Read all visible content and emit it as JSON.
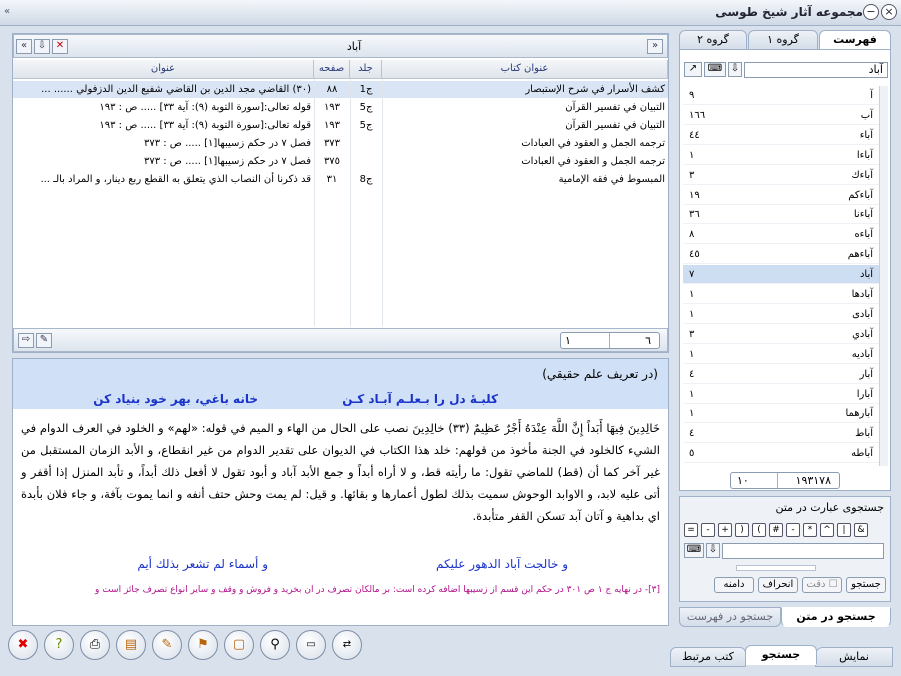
{
  "window": {
    "title": "مجموعه آثار شیخ طوسی",
    "close_icon": "×",
    "minimize_icon": "−",
    "left_arrow": "«"
  },
  "results": {
    "header_title": "آباد",
    "nav_left": "«",
    "nav_right": "»",
    "columns": {
      "book": "عنوان کتاب",
      "volume": "جلد",
      "page": "صفحه",
      "title": "عنوان"
    },
    "rows": [
      {
        "book": "كشف الأسرار في شرح الإستبصار",
        "volume": "ج1",
        "page": "٨٨",
        "title": "(٣٠) القاضي مجد الدين بن القاضي شفيع الدين الدزفولي ...... ...",
        "selected": true
      },
      {
        "book": "التبيان في تفسير القرآن",
        "volume": "ج5",
        "page": "١٩٣",
        "title": "قوله تعالى:[سورة التوبة (٩): آية ٣٣] ..... ص : ١٩٣",
        "selected": false
      },
      {
        "book": "التبيان في تفسير القرآن",
        "volume": "ج5",
        "page": "١٩٣",
        "title": "قوله تعالى:[سورة التوبة (٩): آية ٣٣] ..... ص : ١٩٣",
        "selected": false
      },
      {
        "book": "ترجمه الجمل و العقود في العبادات",
        "volume": "",
        "page": "٣٧٣",
        "title": "فصل ٧ در حكم زسيبها[١] ..... ص : ٣٧٣",
        "selected": false
      },
      {
        "book": "ترجمه الجمل و العقود في العبادات",
        "volume": "",
        "page": "٣٧٥",
        "title": "فصل ٧ در حكم زسيبها[١] ..... ص : ٣٧٣",
        "selected": false
      },
      {
        "book": "المبسوط في فقه الإمامية",
        "volume": "ج8",
        "page": "٣١",
        "title": "قد ذكرنا أن النصاب الذي يتعلق به القطع ربع دينار، و المراد بالـ ...",
        "selected": false
      }
    ],
    "pager_current": "٦",
    "pager_total": "١"
  },
  "detail": {
    "heading": "(در تعريف علم حقيقي)",
    "verse_right": "كلبـهٔ دل را بـعلـم آبـاد كـن",
    "verse_left": "خانه باغي، بهر خود بنياد كن",
    "para": "خَالِدِينَ فِيهَا أَبَداً إِنَّ اللَّهَ عِنْدَهُ أَجْرٌ عَظِيمٌ (٣٣) خالِدِينَ نصب على الحال من الهاء و الميم في قوله: «لهم» و الخلود في العرف الدوام في الشيء كالخلود في الجنة مأخوذ من قولهم: خلد هذا الكتاب في الديوان على تقدير الدوام من غير انقطاع، و الأبد الزمان المستقبل من غير آخر كما أن (قط) للماضي تقول: ما رأيته قط، و لا أراه أبداً و جمع الأبد آباد و أبود تقول لا أفعل ذلك أبداً، و تأبد المنزل إذا أقفر و أتى عليه لابد، و الاوابد الوحوش سميت بذلك لطول أعمارها و بقائها. و قيل: لم يمت وحش حتف أنفه و انما يموت بآفة، و جاء فلان بأبدة اي بداهية و آتان آبد تسكن القفر متأبدة.",
    "verse2_right": "و خالجت آباد الدهور عليكم",
    "verse2_left": "و أسماء لم تشعر بذلك أيم",
    "footnote": "[٣]- در نهايه ج ١ ص ٣٠١ در حكم اين قسم از زسيبها اضافه كرده است: بر مالكان تصرف در آن بخريد و فروش و وقف و ساير انواع تصرف جائز است و"
  },
  "right_panel": {
    "tabs": [
      "فهرست",
      "گروه ١",
      "گروه ٢"
    ],
    "search_value": "آباد",
    "words": [
      {
        "w": "آ",
        "c": "٩"
      },
      {
        "w": "آب",
        "c": "١٦٦"
      },
      {
        "w": "آباء",
        "c": "٤٤"
      },
      {
        "w": "آباءا",
        "c": "١"
      },
      {
        "w": "آباءك",
        "c": "٣"
      },
      {
        "w": "آباءكم",
        "c": "١٩"
      },
      {
        "w": "آباءنا",
        "c": "٣٦"
      },
      {
        "w": "آباءه",
        "c": "٨"
      },
      {
        "w": "آباءهم",
        "c": "٤٥"
      },
      {
        "w": "آباد",
        "c": "٧",
        "selected": true
      },
      {
        "w": "آبادها",
        "c": "١"
      },
      {
        "w": "آبادى",
        "c": "١"
      },
      {
        "w": "آبادي",
        "c": "٣"
      },
      {
        "w": "آباديه",
        "c": "١"
      },
      {
        "w": "آبار",
        "c": "٤"
      },
      {
        "w": "آبارا",
        "c": "١"
      },
      {
        "w": "آبارهما",
        "c": "١"
      },
      {
        "w": "آباط",
        "c": "٤"
      },
      {
        "w": "آباطه",
        "c": "٥"
      }
    ],
    "total": "١٩٣١٧٨",
    "total_small": "١٠",
    "text_search_title": "جستجوی عبارت در متن",
    "symbols": [
      "&",
      "|",
      "^",
      "*",
      "-",
      "#",
      "(",
      ")",
      "+",
      "-",
      "="
    ],
    "search_button": "جستجو",
    "accuracy_label": "دقت",
    "deviation_button": "انحراف",
    "range_button": "دامنه",
    "bottom_tabs": [
      "جستجو در متن",
      "جستجو در فهرست"
    ]
  },
  "footer_tabs": [
    "نمايش",
    "جستجو",
    "كتب مرتبط"
  ],
  "toolbar": [
    "close",
    "help",
    "print",
    "books",
    "edit",
    "bookmark-add",
    "note",
    "search",
    "text-size",
    "compare"
  ]
}
